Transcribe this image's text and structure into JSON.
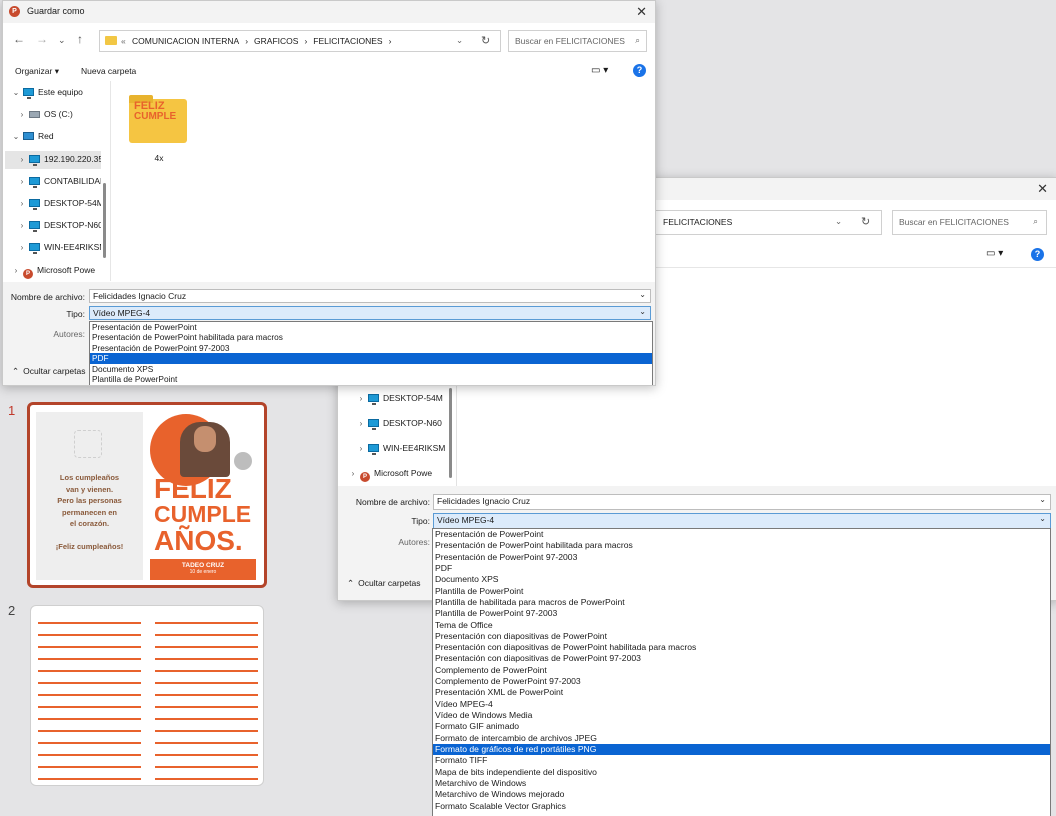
{
  "dialog1": {
    "title": "Guardar como",
    "app_icon": "P",
    "breadcrumb_prefix": "«",
    "breadcrumb": [
      "COMUNICACION INTERNA",
      "GRAFICOS",
      "FELICITACIONES"
    ],
    "search_placeholder": "Buscar en FELICITACIONES",
    "toolbar": {
      "organize": "Organizar",
      "new_folder": "Nueva carpeta"
    },
    "tree": [
      {
        "label": "Este equipo",
        "icon": "pc"
      },
      {
        "label": "OS (C:)",
        "icon": "drive"
      },
      {
        "label": "Red",
        "icon": "network"
      },
      {
        "label": "192.190.220.35",
        "icon": "pc"
      },
      {
        "label": "CONTABILIDAD",
        "icon": "pc"
      },
      {
        "label": "DESKTOP-54M",
        "icon": "pc"
      },
      {
        "label": "DESKTOP-N60",
        "icon": "pc"
      },
      {
        "label": "WIN-EE4RIKSM",
        "icon": "pc"
      },
      {
        "label": "Microsoft Powe",
        "icon": "ppt"
      }
    ],
    "folder": {
      "label": "4x",
      "thumb_text_1": "FELIZ",
      "thumb_text_2": "CUMPLE"
    },
    "filename_label": "Nombre de archivo:",
    "filename_value": "Felicidades Ignacio Cruz",
    "type_label": "Tipo:",
    "type_value": "Vídeo MPEG-4",
    "authors_label": "Autores:",
    "hide_folders": "Ocultar carpetas",
    "dropdown": [
      "Presentación de PowerPoint",
      "Presentación de PowerPoint habilitada para macros",
      "Presentación de PowerPoint 97-2003",
      "PDF",
      "Documento XPS",
      "Plantilla de PowerPoint",
      "Plantilla de habilitada para macros de PowerPoint"
    ],
    "dropdown_selected": "PDF"
  },
  "dialog2": {
    "breadcrumb": "FELICITACIONES",
    "search_placeholder": "Buscar en FELICITACIONES",
    "tree": [
      {
        "label": "DESKTOP-54M",
        "icon": "pc"
      },
      {
        "label": "DESKTOP-N60",
        "icon": "pc"
      },
      {
        "label": "WIN-EE4RIKSM",
        "icon": "pc"
      },
      {
        "label": "Microsoft Powe",
        "icon": "ppt"
      }
    ],
    "filename_label": "Nombre de archivo:",
    "filename_value": "Felicidades Ignacio Cruz",
    "type_label": "Tipo:",
    "type_value": "Vídeo MPEG-4",
    "authors_label": "Autores:",
    "hide_folders": "Ocultar carpetas",
    "dropdown": [
      "Presentación de PowerPoint",
      "Presentación de PowerPoint habilitada para macros",
      "Presentación de PowerPoint 97-2003",
      "PDF",
      "Documento XPS",
      "Plantilla de PowerPoint",
      "Plantilla de habilitada para macros de PowerPoint",
      "Plantilla de PowerPoint 97-2003",
      "Tema de Office",
      "Presentación con diapositivas de PowerPoint",
      "Presentación con diapositivas de PowerPoint habilitada para macros",
      "Presentación con diapositivas de PowerPoint 97-2003",
      "Complemento de PowerPoint",
      "Complemento de PowerPoint 97-2003",
      "Presentación XML de PowerPoint",
      "Vídeo MPEG-4",
      "Vídeo de Windows Media",
      "Formato GIF animado",
      "Formato de intercambio de archivos JPEG",
      "Formato de gráficos de red portátiles PNG",
      "Formato TIFF",
      "Mapa de bits independiente del dispositivo",
      "Metarchivo de Windows",
      "Metarchivo de Windows mejorado",
      "Formato Scalable Vector Graphics"
    ],
    "dropdown_selected": "Formato de gráficos de red portátiles PNG"
  },
  "slides": [
    {
      "number": "1",
      "left_text": [
        "Los cumpleaños",
        "van y vienen.",
        "Pero las personas",
        "permanecen en",
        "el corazón.",
        "",
        "¡Feliz cumpleaños!"
      ],
      "big_lines": [
        "FELIZ",
        "CUMPLE",
        "AÑOS."
      ],
      "name": "TADEO CRUZ",
      "date": "10 de enero"
    },
    {
      "number": "2"
    }
  ],
  "colors": {
    "accent_orange": "#e8622c",
    "select_blue": "#0a64d2",
    "slide_border": "#b3442a"
  }
}
